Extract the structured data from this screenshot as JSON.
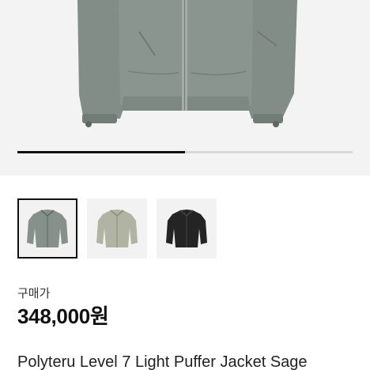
{
  "gallery": {
    "progress": 0.5,
    "active_index": 0
  },
  "thumbnails": [
    {
      "icon": "sage-jacket-icon",
      "color": "#87918b"
    },
    {
      "icon": "khaki-jacket-icon",
      "color": "#b1b4a2"
    },
    {
      "icon": "black-jacket-icon",
      "color": "#242424"
    }
  ],
  "product": {
    "price_label": "구매가",
    "price": "348,000원",
    "title": "Polyteru Level 7 Light Puffer Jacket Sage"
  }
}
